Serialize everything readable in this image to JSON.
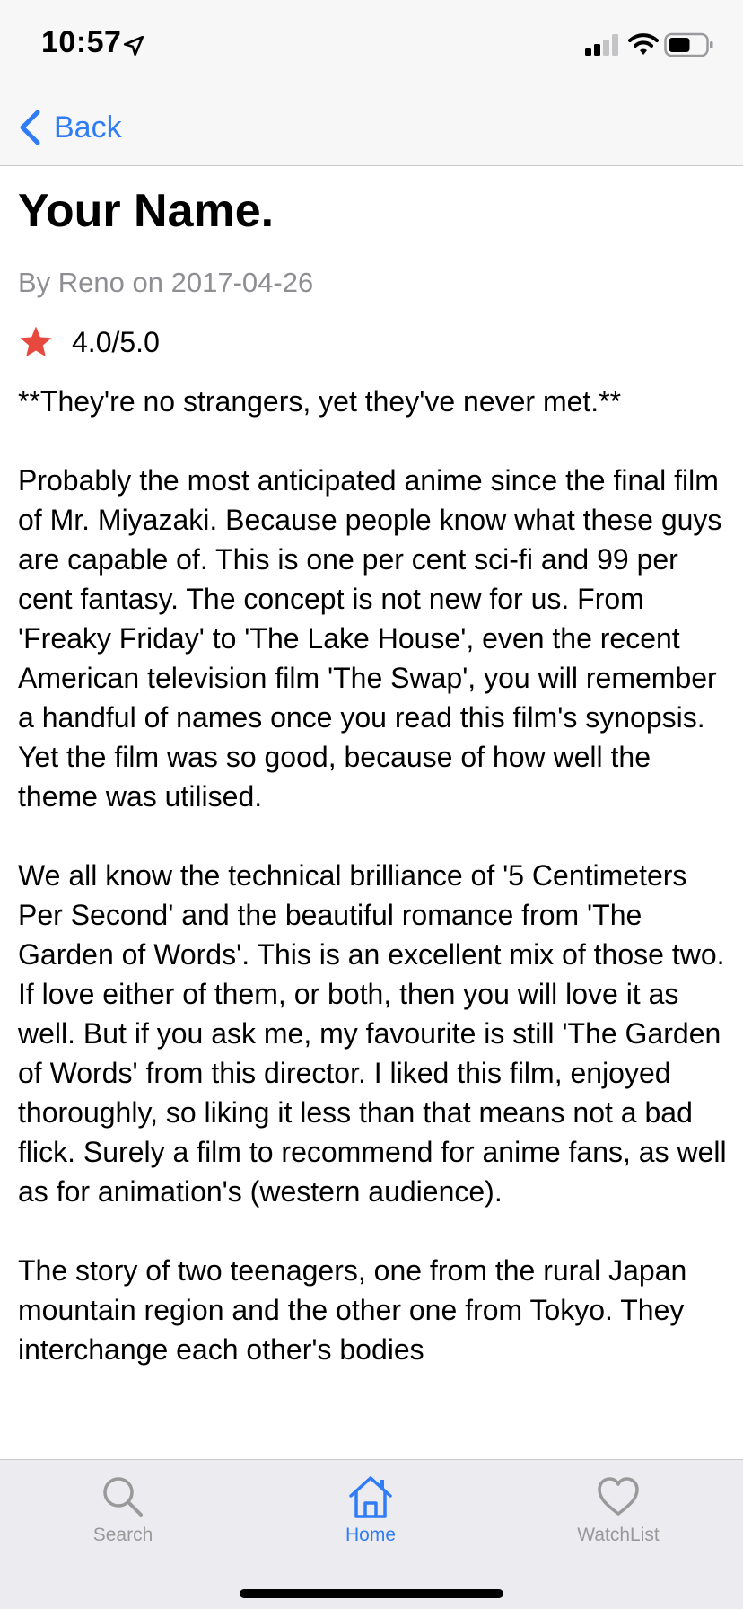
{
  "status_bar": {
    "time": "10:57"
  },
  "nav": {
    "back_label": "Back"
  },
  "review": {
    "title": "Your Name.",
    "byline": "By Reno on 2017-04-26",
    "rating_text": "4.0/5.0",
    "rating_value": 4.0,
    "rating_max": 5.0,
    "paragraphs": [
      "**They're no strangers, yet they've never met.**",
      "Probably the most anticipated anime since the final film of Mr. Miyazaki. Because people know what these guys are capable of. This is one per cent sci-fi and 99 per cent fantasy. The concept is not new for us. From 'Freaky Friday' to 'The Lake House', even the recent American television film 'The Swap', you will remember a handful of names once you read this film's synopsis. Yet the film was so good, because of how well the theme was utilised.",
      "We all know the technical brilliance of '5 Centimeters Per Second' and the beautiful romance from 'The Garden of Words'. This is an excellent mix of those two. If love either of them, or both, then you will love it as well. But if you ask me, my favourite is still 'The Garden of Words' from this director. I liked this film, enjoyed thoroughly, so liking it less than that means not a bad flick. Surely a film to recommend for anime fans, as well as for animation's (western audience).",
      "The story of two teenagers, one from the rural Japan mountain region and the other one from Tokyo. They interchange each other's bodies"
    ]
  },
  "tabs": [
    {
      "label": "Search",
      "icon": "magnifier-icon",
      "active": false
    },
    {
      "label": "Home",
      "icon": "house-icon",
      "active": true
    },
    {
      "label": "WatchList",
      "icon": "heart-icon",
      "active": false
    }
  ],
  "colors": {
    "accent": "#2f7cf6",
    "star": "#e8493e",
    "secondary_text": "#8e8e93",
    "inactive_tab": "#999999",
    "bar_background": "#f7f7f7",
    "tab_bar_background": "#ececf0"
  }
}
